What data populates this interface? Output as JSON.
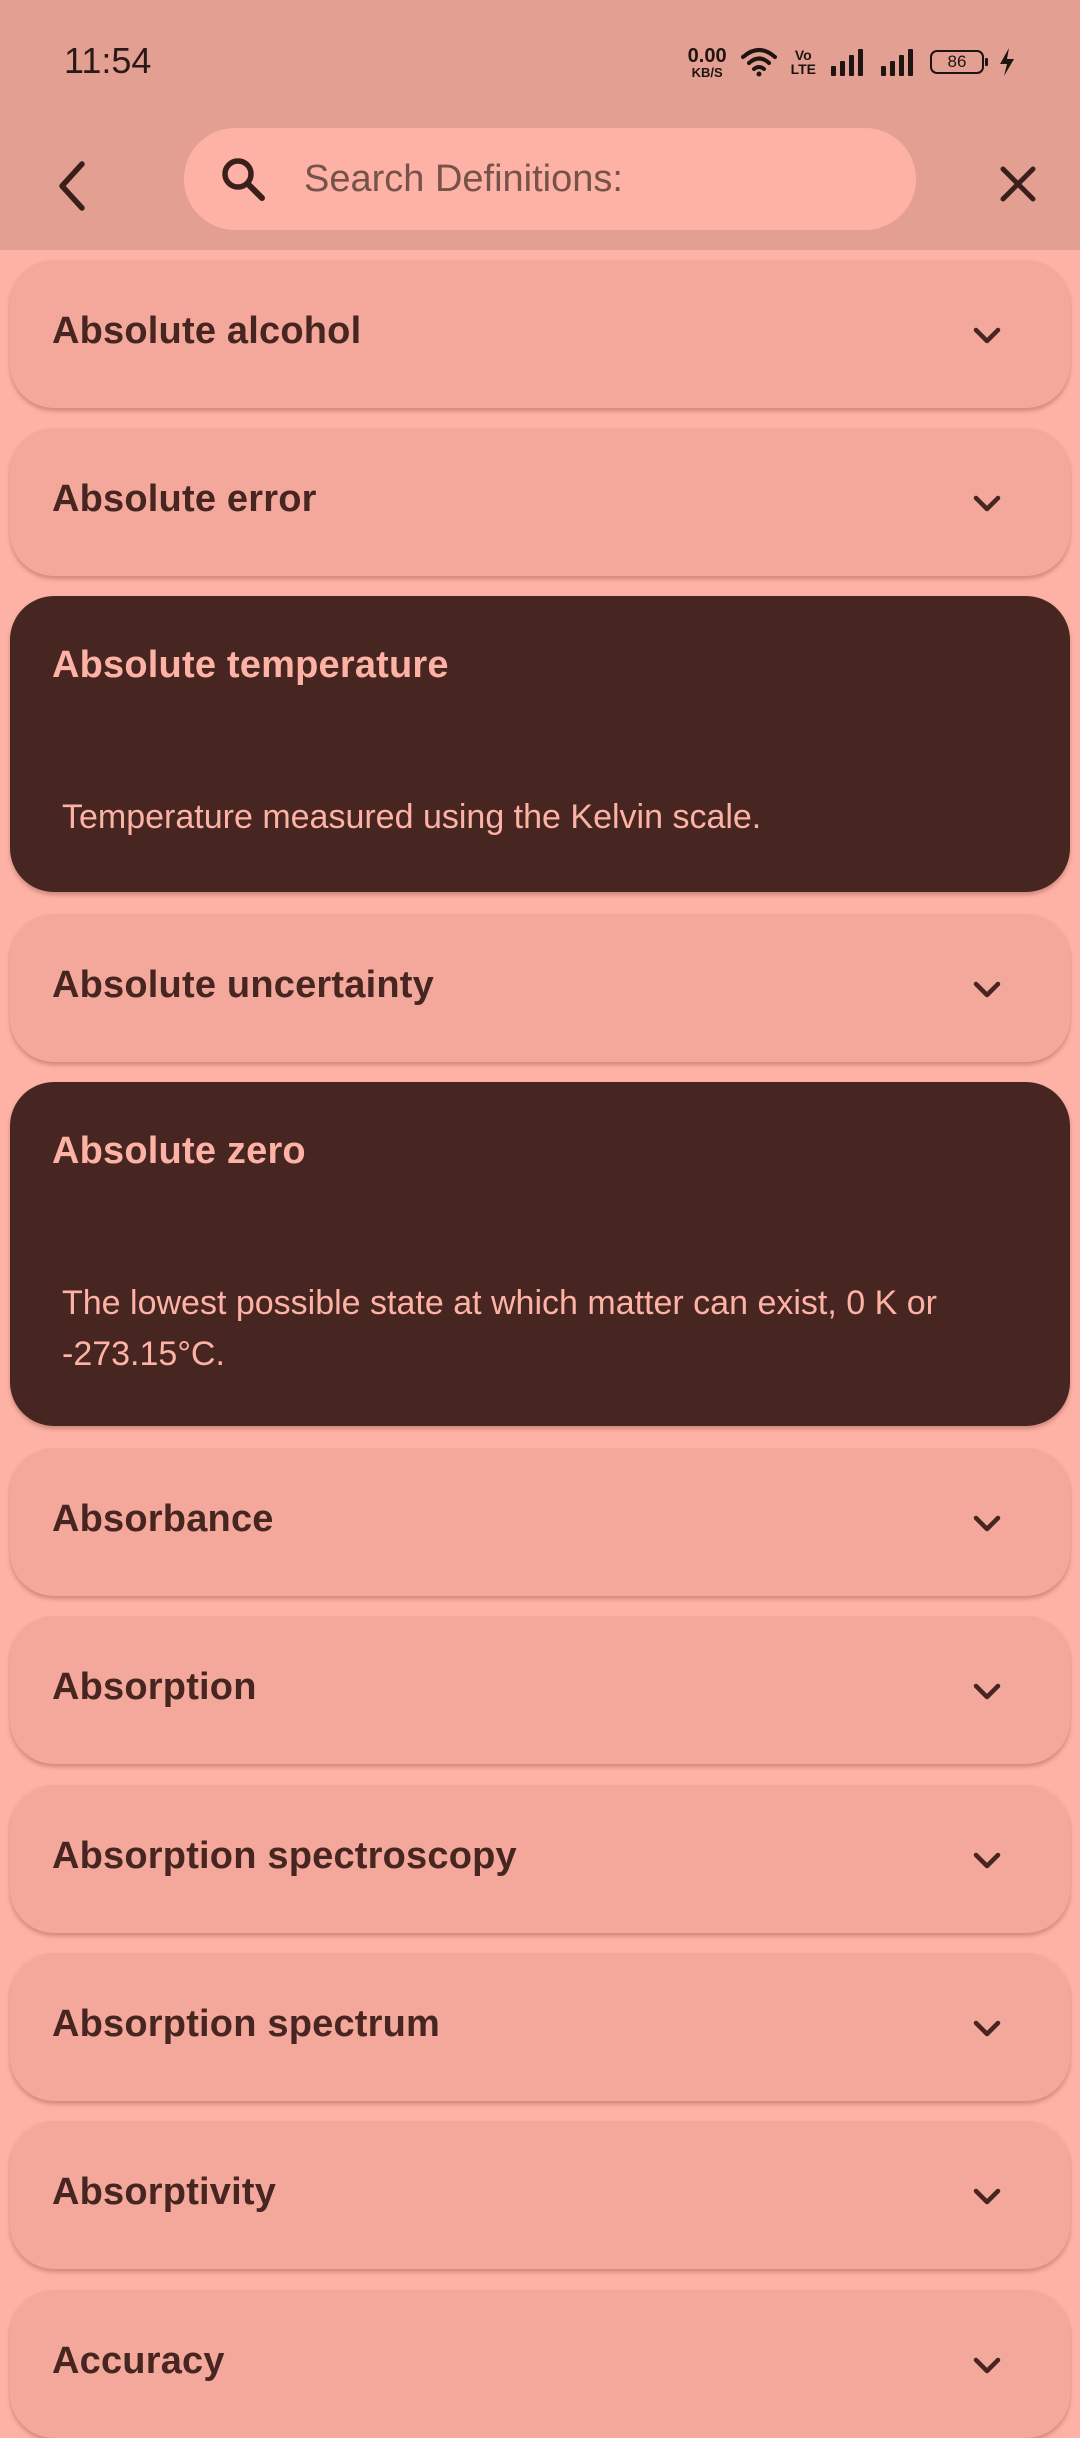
{
  "status_bar": {
    "time": "11:54",
    "net_speed_value": "0.00",
    "net_speed_unit": "KB/S",
    "volte_top": "Vo",
    "volte_bottom": "LTE",
    "battery_level": "86",
    "icons": [
      "wifi-icon",
      "signal-icon",
      "signal-icon",
      "battery-icon",
      "charging-icon"
    ]
  },
  "app_bar": {
    "back_icon": "chevron-left-icon",
    "search_placeholder": "Search Definitions:",
    "search_value": "",
    "close_icon": "close-icon"
  },
  "colors": {
    "background": "#feb2a5",
    "app_bar": "#e3a092",
    "card_collapsed": "#f3a89b",
    "card_expanded": "#472621",
    "text_dark": "#472621",
    "text_light": "#feb2a5"
  },
  "terms": [
    {
      "title": "Absolute alcohol",
      "expanded": false,
      "definition": ""
    },
    {
      "title": "Absolute error",
      "expanded": false,
      "definition": ""
    },
    {
      "title": "Absolute temperature",
      "expanded": true,
      "definition": "Temperature measured using the Kelvin scale."
    },
    {
      "title": "Absolute uncertainty",
      "expanded": false,
      "definition": ""
    },
    {
      "title": "Absolute zero",
      "expanded": true,
      "definition": "The lowest possible state at which matter can exist, 0 K or -273.15°C."
    },
    {
      "title": "Absorbance",
      "expanded": false,
      "definition": ""
    },
    {
      "title": "Absorption",
      "expanded": false,
      "definition": ""
    },
    {
      "title": "Absorption spectroscopy",
      "expanded": false,
      "definition": ""
    },
    {
      "title": "Absorption spectrum",
      "expanded": false,
      "definition": ""
    },
    {
      "title": "Absorptivity",
      "expanded": false,
      "definition": ""
    },
    {
      "title": "Accuracy",
      "expanded": false,
      "definition": ""
    }
  ]
}
